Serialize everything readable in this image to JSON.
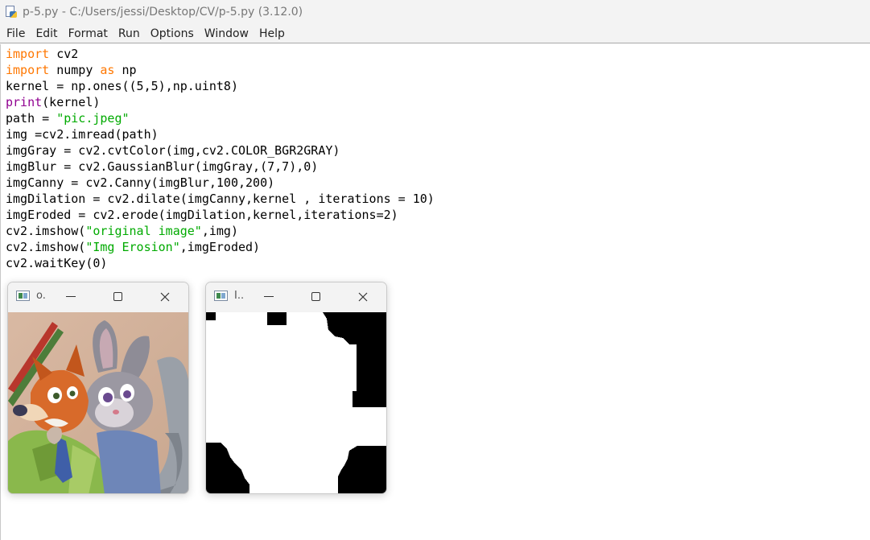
{
  "window": {
    "title": "p-5.py - C:/Users/jessi/Desktop/CV/p-5.py (3.12.0)"
  },
  "menu": [
    "File",
    "Edit",
    "Format",
    "Run",
    "Options",
    "Window",
    "Help"
  ],
  "code": {
    "lines": [
      [
        {
          "t": "import",
          "c": "kw"
        },
        {
          "t": " cv2"
        }
      ],
      [
        {
          "t": "import",
          "c": "kw"
        },
        {
          "t": " numpy "
        },
        {
          "t": "as",
          "c": "kw"
        },
        {
          "t": " np"
        }
      ],
      [
        {
          "t": "kernel = np.ones((5,5),np.uint8)"
        }
      ],
      [
        {
          "t": "print",
          "c": "bi"
        },
        {
          "t": "(kernel)"
        }
      ],
      [
        {
          "t": "path = "
        },
        {
          "t": "\"pic.jpeg\"",
          "c": "str"
        }
      ],
      [
        {
          "t": "img =cv2.imread(path)"
        }
      ],
      [
        {
          "t": "imgGray = cv2.cvtColor(img,cv2.COLOR_BGR2GRAY)"
        }
      ],
      [
        {
          "t": "imgBlur = cv2.GaussianBlur(imgGray,(7,7),0)"
        }
      ],
      [
        {
          "t": "imgCanny = cv2.Canny(imgBlur,100,200)"
        }
      ],
      [
        {
          "t": "imgDilation = cv2.dilate(imgCanny,kernel , iterations = 10)"
        }
      ],
      [
        {
          "t": "imgEroded = cv2.erode(imgDilation,kernel,iterations=2)"
        }
      ],
      [
        {
          "t": "cv2.imshow("
        },
        {
          "t": "\"original image\"",
          "c": "str"
        },
        {
          "t": ",img)"
        }
      ],
      [
        {
          "t": "cv2.imshow("
        },
        {
          "t": "\"Img Erosion\"",
          "c": "str"
        },
        {
          "t": ",imgEroded)"
        }
      ],
      [
        {
          "t": "cv2.waitKey(0)"
        }
      ]
    ]
  },
  "cv_windows": [
    {
      "title": "o.",
      "icon": "opencv-window-icon",
      "image": "original-image-drawing"
    },
    {
      "title": "I..",
      "icon": "opencv-window-icon",
      "image": "eroded-binary-image"
    }
  ],
  "colors": {
    "keyword": "#ff7700",
    "builtin": "#900090",
    "string": "#00aa00",
    "chrome": "#f3f3f3"
  }
}
